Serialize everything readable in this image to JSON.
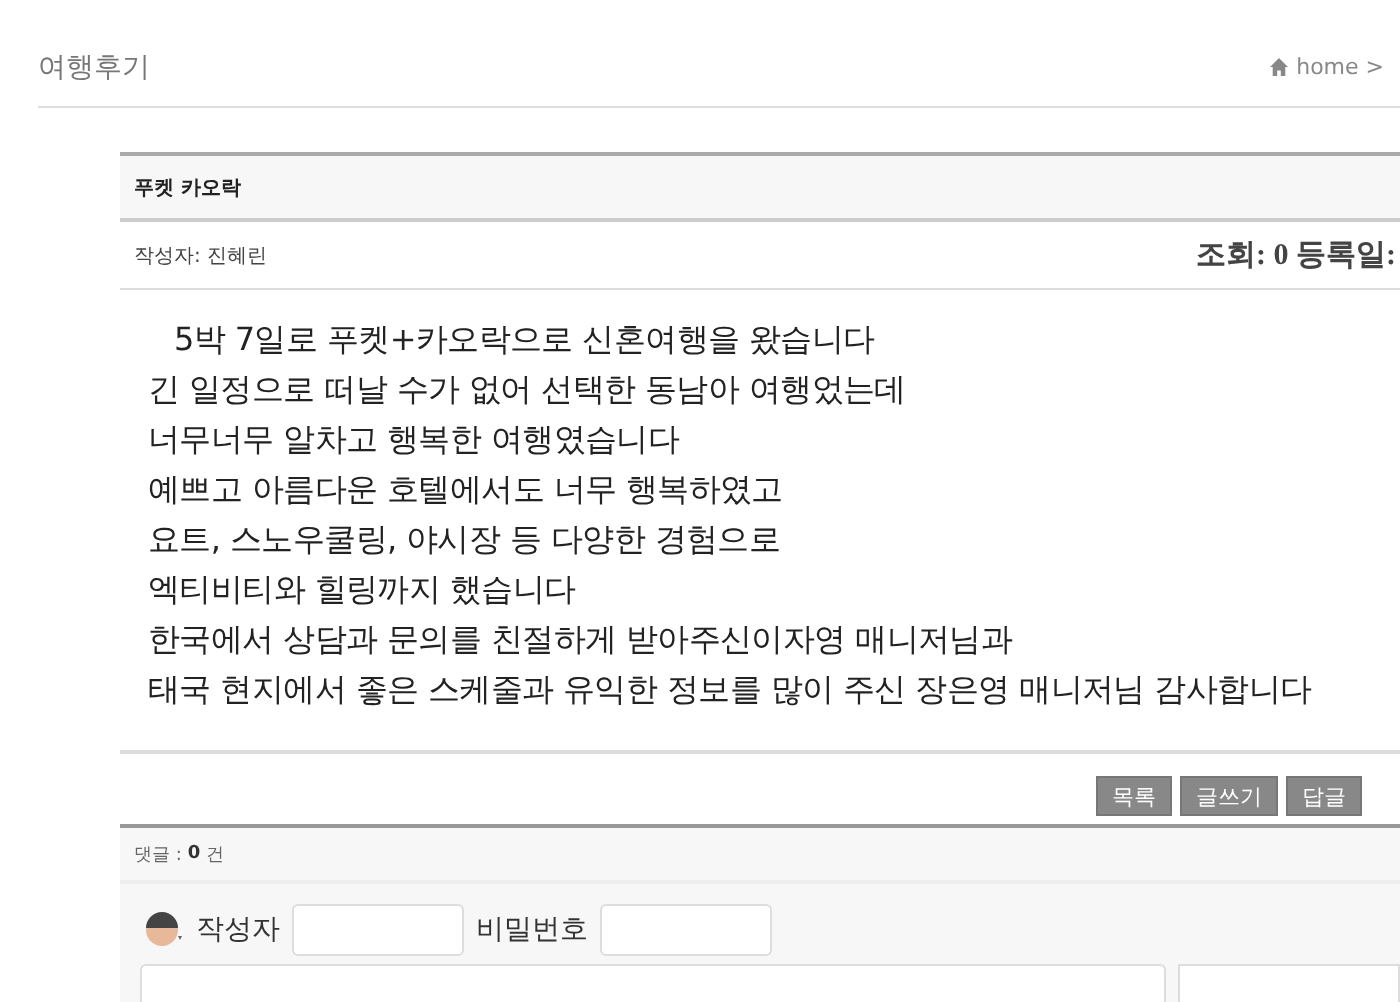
{
  "page_title": "여행후기",
  "breadcrumb": "home >",
  "post": {
    "title": "푸켓 카오락",
    "author_label": "작성자:",
    "author": "진혜린",
    "views_label": "조회:",
    "views": "0",
    "date_label": "등록일:",
    "body": [
      "5박 7일로 푸켓+카오락으로 신혼여행을 왔습니다",
      "긴 일정으로 떠날 수가 없어 선택한 동남아 여행었는데",
      "너무너무 알차고 행복한 여행였습니다",
      "예쁘고 아름다운 호텔에서도 너무 행복하였고",
      "요트, 스노우쿨링, 야시장 등 다양한 경험으로",
      "엑티비티와 힐링까지 했습니다",
      "한국에서 상담과 문의를 친절하게 받아주신이자영 매니저님과",
      "태국 현지에서 좋은 스케줄과 유익한 정보를 많이 주신 장은영 매니저님 감사합니다"
    ]
  },
  "buttons": [
    "목록",
    "글쓰기",
    "답글"
  ],
  "comments": {
    "label": "댓글 :",
    "count": "0",
    "unit": "건",
    "author_label": "작성자",
    "password_label": "비밀번호"
  }
}
